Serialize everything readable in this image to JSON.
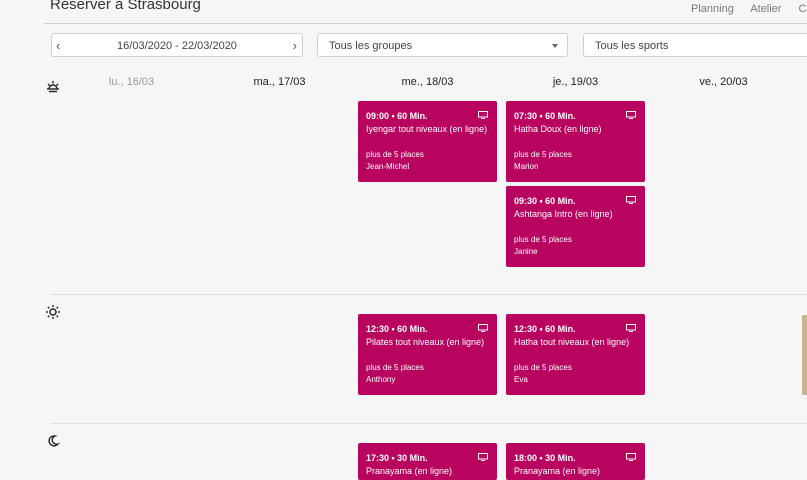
{
  "header": {
    "title": "Réserver à Strasbourg",
    "nav": [
      "Planning",
      "Atelier",
      "Ca"
    ]
  },
  "filters": {
    "date_range": "16/03/2020 - 22/03/2020",
    "groups": "Tous les groupes",
    "sports": "Tous les sports"
  },
  "days": [
    "lu., 16/03",
    "ma., 17/03",
    "me., 18/03",
    "je., 19/03",
    "ve., 20/03"
  ],
  "icons": {
    "morning": "sunrise-icon",
    "midday": "sun-icon",
    "evening": "moon-icon",
    "online": "monitor-icon",
    "prev": "chevron-left-icon",
    "next": "chevron-right-icon",
    "dropdown": "caret-down-icon"
  },
  "colors": {
    "card": "#b8045f",
    "accent_edge": "#c8b48c"
  },
  "sessions": {
    "me_morning": {
      "time": "09:00 • 60 Min.",
      "name": "Iyengar tout niveaux (en ligne)",
      "places": "plus de 5 places",
      "teacher": "Jean-Michel"
    },
    "je_morning_1": {
      "time": "07:30 • 60 Min.",
      "name": "Hatha Doux (en ligne)",
      "places": "plus de 5 places",
      "teacher": "Marion"
    },
    "je_morning_2": {
      "time": "09:30 • 60 Min.",
      "name": "Ashtanga Intro (en ligne)",
      "places": "plus de 5 places",
      "teacher": "Janine"
    },
    "me_midday": {
      "time": "12:30 • 60 Min.",
      "name": "Pilates tout niveaux (en ligne)",
      "places": "plus de 5 places",
      "teacher": "Anthony"
    },
    "je_midday": {
      "time": "12:30 • 60 Min.",
      "name": "Hatha tout niveaux (en ligne)",
      "places": "plus de 5 places",
      "teacher": "Eva"
    },
    "me_evening": {
      "time": "17:30 • 30 Min.",
      "name": "Pranayama (en ligne)"
    },
    "je_evening": {
      "time": "18:00 • 30 Min.",
      "name": "Pranayama (en ligne)"
    }
  }
}
